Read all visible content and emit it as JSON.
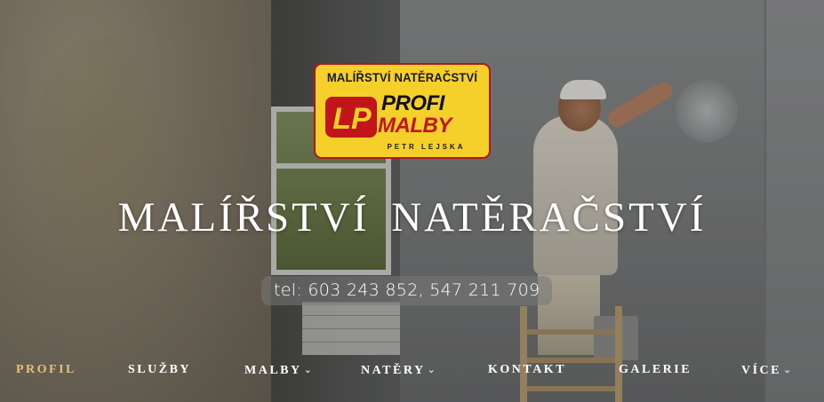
{
  "logo": {
    "top_text": "MALÍŘSTVÍ NATĚRAČSTVÍ",
    "monogram": "LP",
    "word1": "PROFI",
    "word2": "MALBY",
    "owner": "PETR LEJSKA",
    "colors": {
      "background": "#f5d02a",
      "accent": "#c1151b",
      "text": "#111111"
    }
  },
  "hero": {
    "title": "MALÍŘSTVÍ NATĚRAČSTVÍ",
    "phone": "tel: 603 243 852, 547 211 709"
  },
  "nav": {
    "active_color": "#e7c07a",
    "items": [
      {
        "label": "PROFIL",
        "active": true,
        "dropdown": false
      },
      {
        "label": "SLUŽBY",
        "active": false,
        "dropdown": false
      },
      {
        "label": "MALBY",
        "active": false,
        "dropdown": true,
        "icon": "chevron-down-icon"
      },
      {
        "label": "NATĚRY",
        "active": false,
        "dropdown": true,
        "icon": "chevron-down-icon"
      },
      {
        "label": "KONTAKT",
        "active": false,
        "dropdown": false
      },
      {
        "label": "GALERIE",
        "active": false,
        "dropdown": false
      },
      {
        "label": "VÍCE",
        "active": false,
        "dropdown": true,
        "icon": "chevron-down-icon"
      }
    ]
  }
}
